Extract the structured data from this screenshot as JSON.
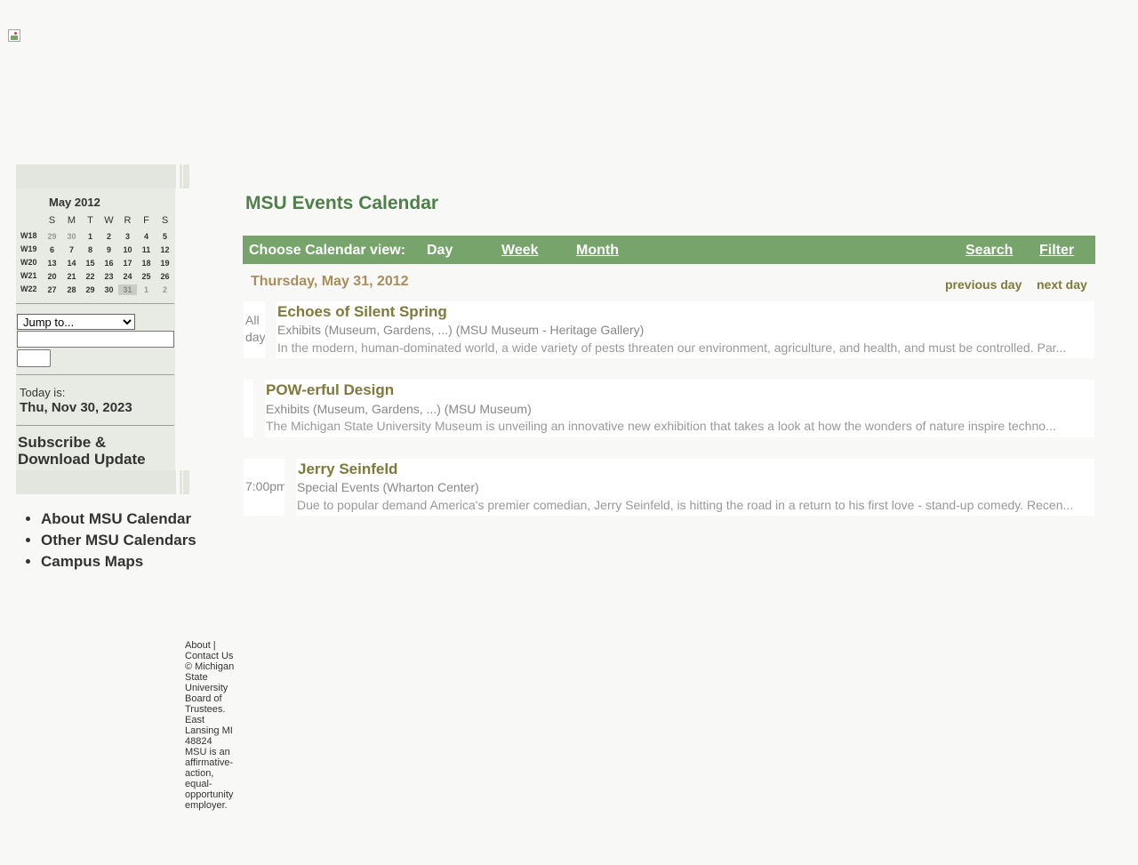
{
  "header": {
    "logo_icon": "broken-image-icon"
  },
  "mini_calendar": {
    "month_label": "May 2012",
    "dow": [
      "S",
      "M",
      "T",
      "W",
      "R",
      "F",
      "S"
    ],
    "weeks": [
      {
        "label": "W18",
        "days": [
          {
            "d": "29",
            "other": true
          },
          {
            "d": "30",
            "other": true
          },
          {
            "d": "1"
          },
          {
            "d": "2"
          },
          {
            "d": "3"
          },
          {
            "d": "4"
          },
          {
            "d": "5"
          }
        ]
      },
      {
        "label": "W19",
        "days": [
          {
            "d": "6"
          },
          {
            "d": "7"
          },
          {
            "d": "8"
          },
          {
            "d": "9"
          },
          {
            "d": "10"
          },
          {
            "d": "11"
          },
          {
            "d": "12"
          }
        ]
      },
      {
        "label": "W20",
        "days": [
          {
            "d": "13"
          },
          {
            "d": "14"
          },
          {
            "d": "15"
          },
          {
            "d": "16"
          },
          {
            "d": "17"
          },
          {
            "d": "18"
          },
          {
            "d": "19"
          }
        ]
      },
      {
        "label": "W21",
        "days": [
          {
            "d": "20"
          },
          {
            "d": "21"
          },
          {
            "d": "22"
          },
          {
            "d": "23"
          },
          {
            "d": "24"
          },
          {
            "d": "25"
          },
          {
            "d": "26"
          }
        ]
      },
      {
        "label": "W22",
        "days": [
          {
            "d": "27"
          },
          {
            "d": "28"
          },
          {
            "d": "29"
          },
          {
            "d": "30"
          },
          {
            "d": "31",
            "selected": true
          },
          {
            "d": "1",
            "other": true
          },
          {
            "d": "2",
            "other": true
          }
        ]
      }
    ]
  },
  "sidebar": {
    "jump_select": "Jump to...",
    "search_value": "",
    "today_label": "Today is:",
    "today_date": "Thu, Nov 30, 2023",
    "subscribe_label": "Subscribe & Download Update",
    "links": [
      "About MSU Calendar",
      "Other MSU Calendars",
      "Campus Maps"
    ]
  },
  "footer": {
    "text": "About | Contact Us © Michigan State University Board of Trustees. East Lansing MI 48824 MSU is an affirmative-action, equal-opportunity employer."
  },
  "main": {
    "title": "MSU Events Calendar",
    "view_label": "Choose Calendar view:",
    "views": {
      "day": "Day",
      "week": "Week",
      "month": "Month"
    },
    "search": "Search",
    "filter": "Filter",
    "date_heading": "Thursday, May 31, 2012",
    "previous_day": "previous day",
    "next_day": "next day",
    "events": [
      {
        "time_line1": "All",
        "time_line2": "day",
        "title": "Echoes of Silent Spring",
        "category": "Exhibits (Museum, Gardens, ...) (MSU Museum - Heritage Gallery)",
        "description": "In the modern, human-dominated world, a wide variety of pests threaten our environment, agriculture, and health, and must be controlled. Par..."
      },
      {
        "time_line1": "",
        "time_line2": "",
        "title": "POW-erful Design",
        "category": "Exhibits (Museum, Gardens, ...) (MSU Museum)",
        "description": "The Michigan State University Museum is unveiling an innovative new exhibition that takes a look at how the wonders of nature inspire techno..."
      },
      {
        "time_line1": "7:00pm",
        "time_line2": "",
        "title": "Jerry Seinfeld",
        "category": "Special Events (Wharton Center)",
        "description": "Due to popular demand America's premier comedian, Jerry Seinfeld, is hitting the road in a return to his first love - stand-up comedy. Recen..."
      }
    ]
  }
}
